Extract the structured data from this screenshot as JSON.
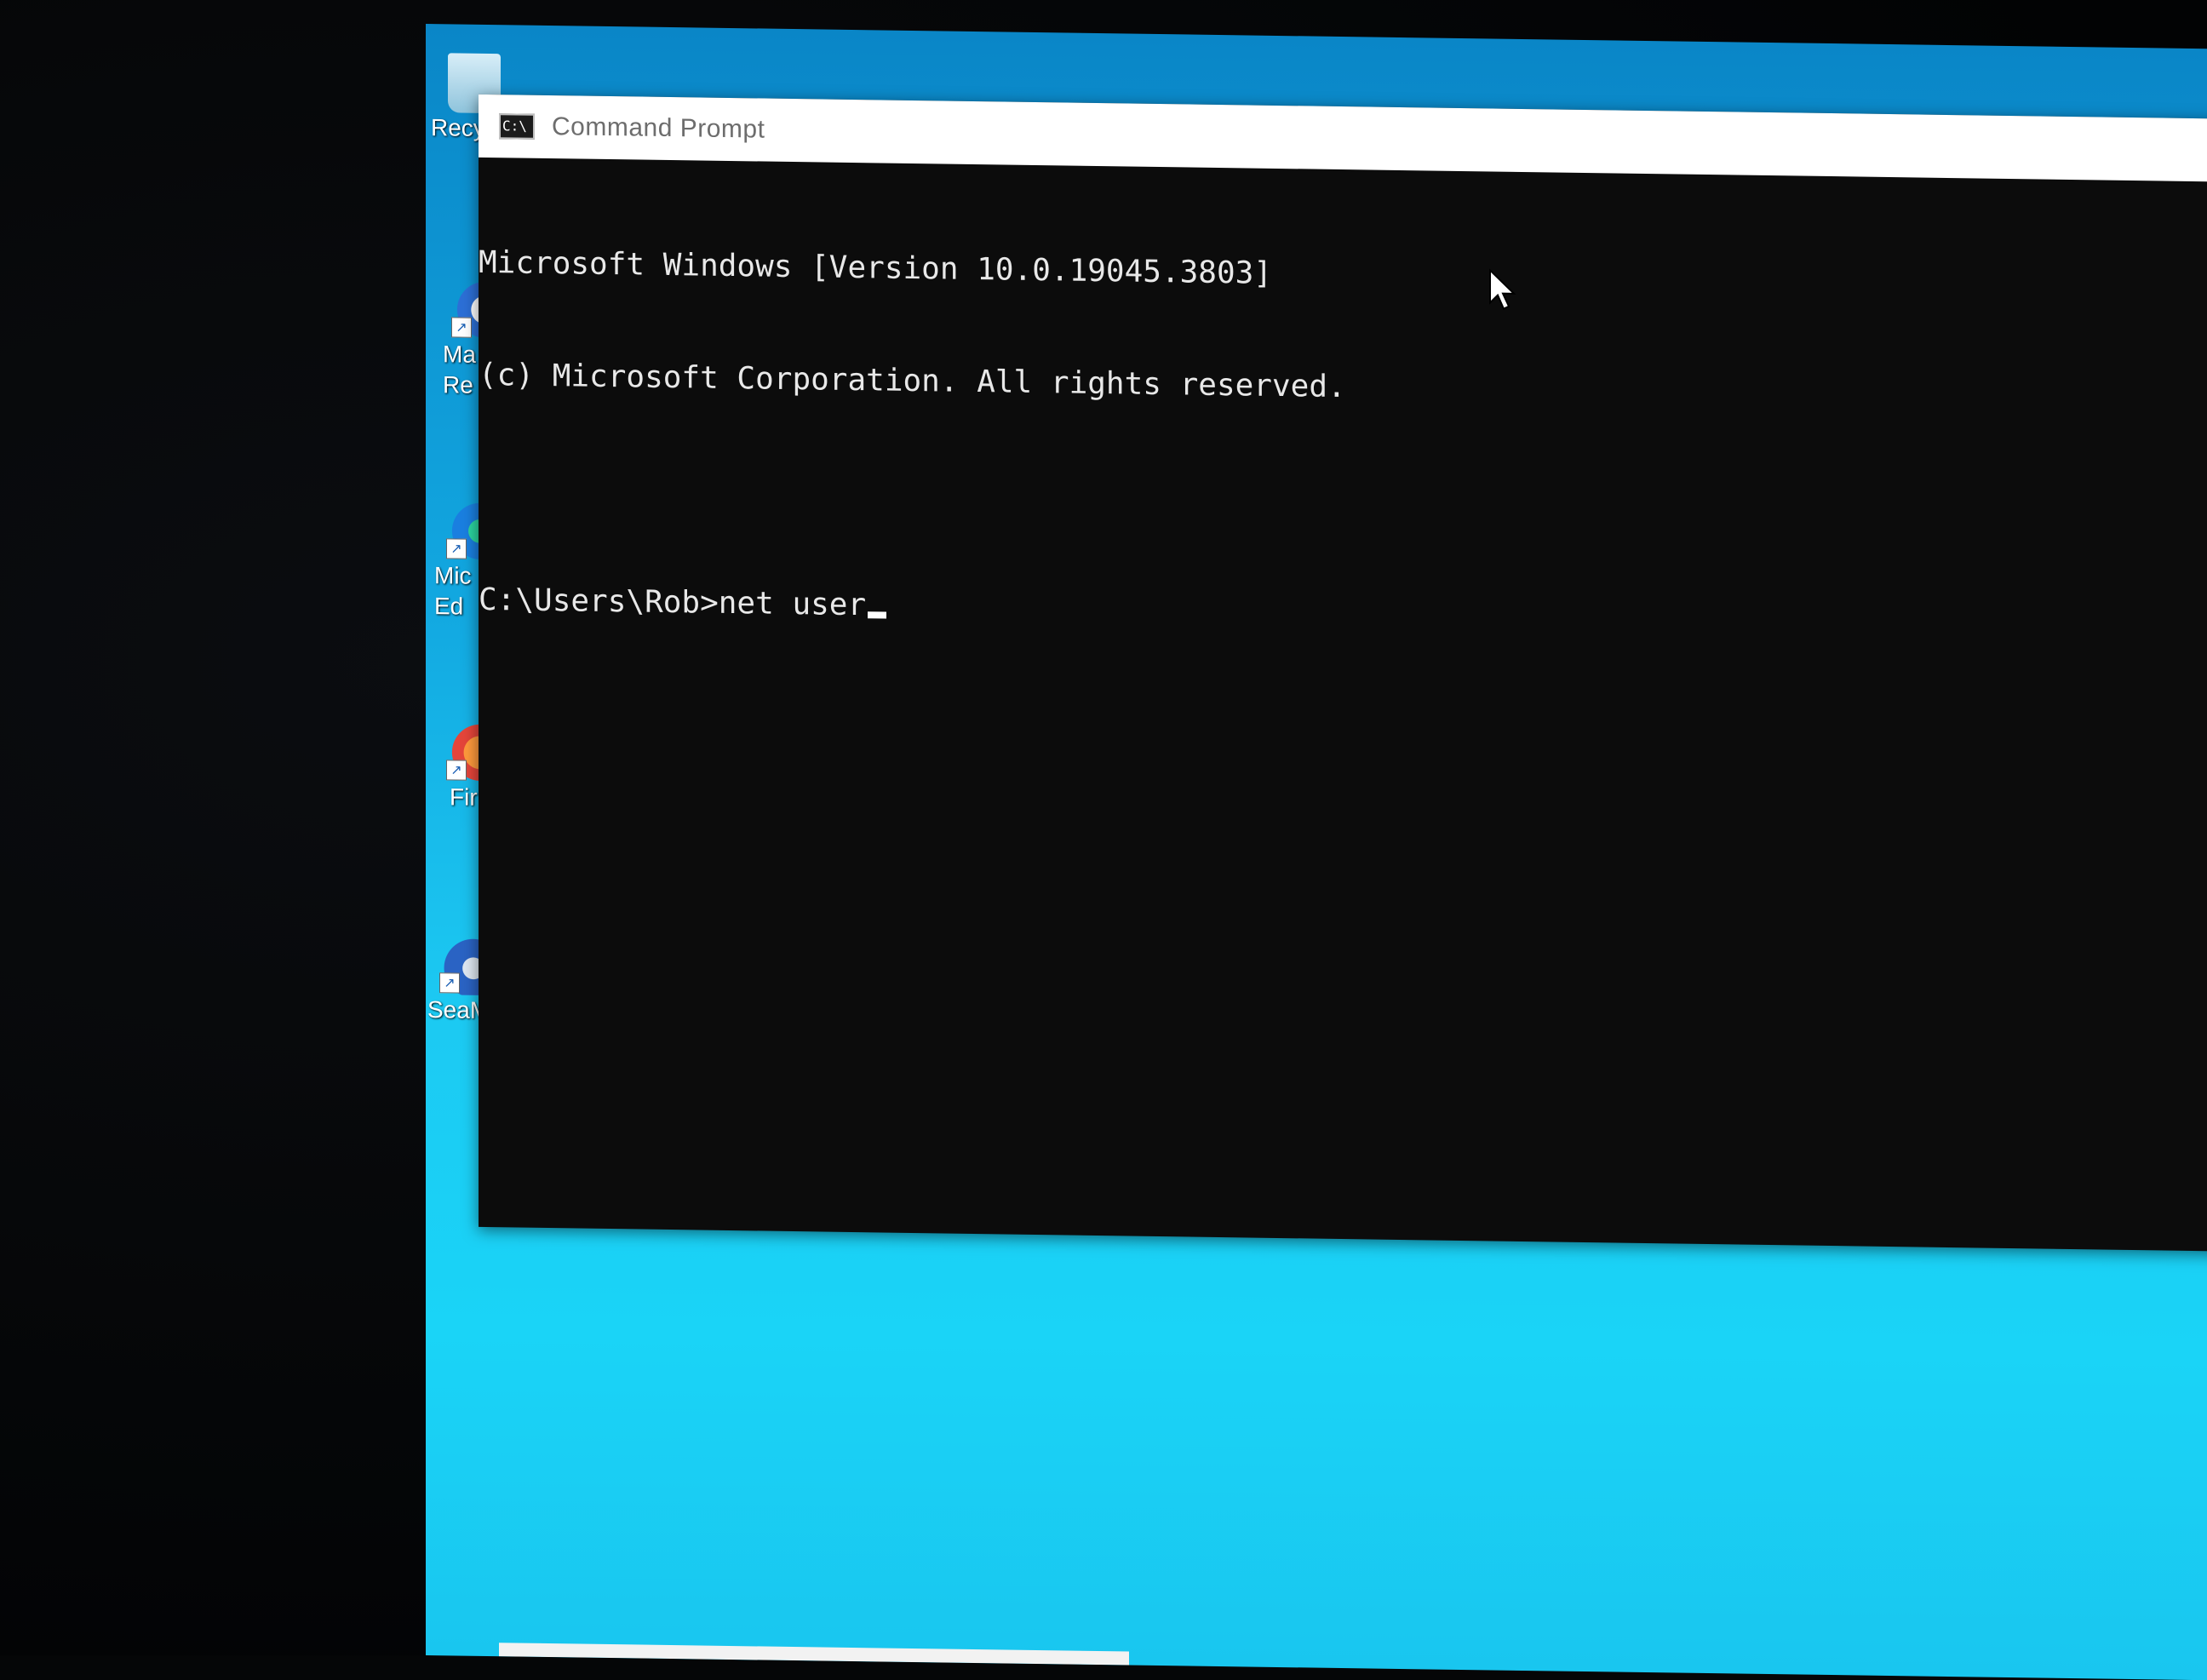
{
  "desktop": {
    "icons": [
      {
        "label": "Recy",
        "icon": "recycle-bin-icon"
      },
      {
        "label": "Ma\nRe",
        "icon": "malwarebytes-icon"
      },
      {
        "label": "Mic\nEd",
        "icon": "edge-icon"
      },
      {
        "label": "Fir",
        "icon": "firefox-icon"
      },
      {
        "label": "SeaM",
        "icon": "seamonkey-icon"
      }
    ]
  },
  "window": {
    "title": "Command Prompt",
    "app_icon_text": "C:\\"
  },
  "console": {
    "lines": [
      "Microsoft Windows [Version 10.0.19045.3803]",
      "(c) Microsoft Corporation. All rights reserved.",
      "",
      "C:\\Users\\Rob>net user"
    ]
  },
  "colors": {
    "desktop_accent": "#1cc9f2",
    "console_bg": "#0c0c0c",
    "console_text": "#e8e8e8",
    "titlebar_bg": "#ffffff"
  }
}
